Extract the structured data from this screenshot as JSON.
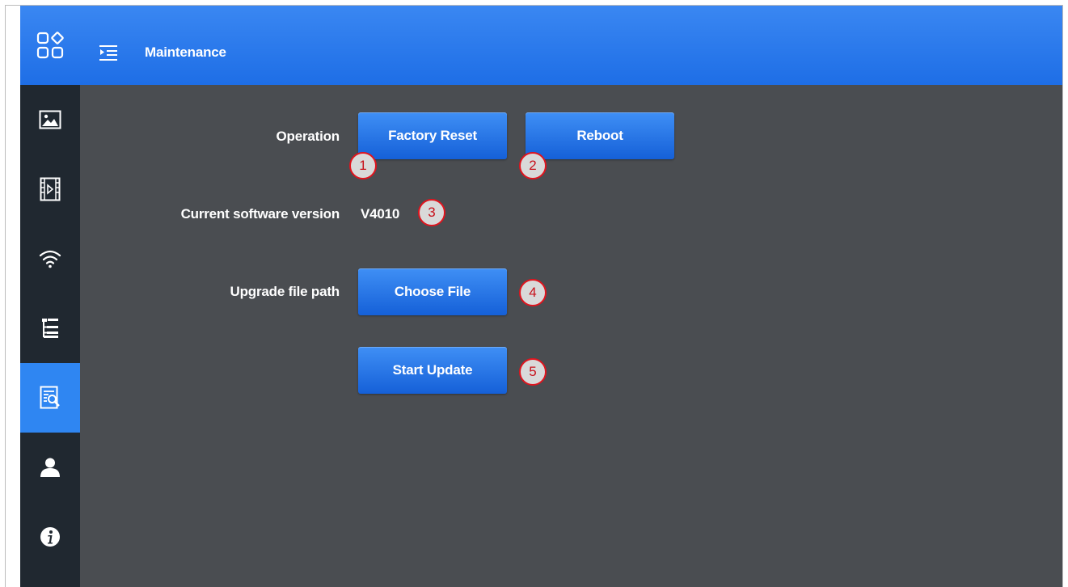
{
  "header": {
    "title": "Maintenance"
  },
  "sidebar": {
    "items": [
      {
        "icon": "image-icon",
        "active": false
      },
      {
        "icon": "video-icon",
        "active": false
      },
      {
        "icon": "wifi-icon",
        "active": false
      },
      {
        "icon": "list-icon",
        "active": false
      },
      {
        "icon": "maintenance-icon",
        "active": true
      },
      {
        "icon": "user-icon",
        "active": false
      },
      {
        "icon": "info-icon",
        "active": false
      }
    ]
  },
  "main": {
    "operation_label": "Operation",
    "factory_reset_label": "Factory Reset",
    "reboot_label": "Reboot",
    "version_label": "Current software version",
    "version_value": "V4010",
    "upgrade_label": "Upgrade file path",
    "choose_file_label": "Choose File",
    "start_update_label": "Start Update"
  },
  "callouts": [
    "1",
    "2",
    "3",
    "4",
    "5"
  ],
  "colors": {
    "accent": "#2f86f2",
    "sidebar": "#202830",
    "content_bg": "#4a4d51",
    "callout_border": "#e0141e"
  }
}
